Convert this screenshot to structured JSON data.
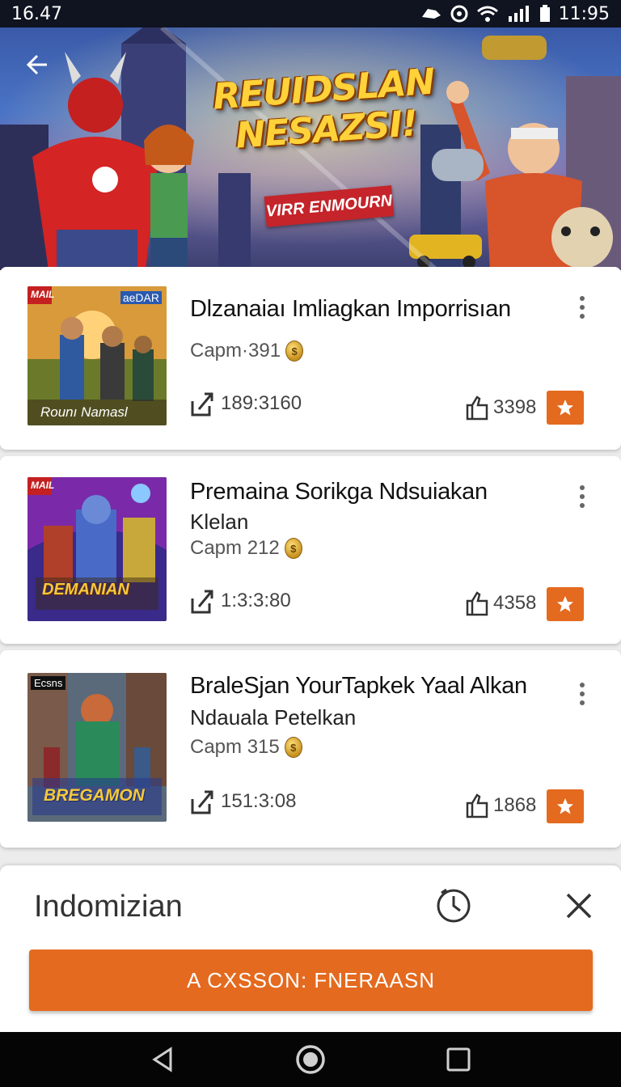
{
  "status_bar": {
    "time": "16.47",
    "clock": "11:95"
  },
  "hero": {
    "title_line1": "REUIDSLAN",
    "title_line2": "NESAZSI!",
    "subtitle": "VIRR ENMOURN"
  },
  "games": [
    {
      "title": "Dlzanaiaı Imliagkan Imporrisıan",
      "subtitle": "",
      "camp": "Capm·391",
      "share_count": "189:3160",
      "likes": "3398",
      "thumb_badge_left": "MAIL",
      "thumb_badge_right": "aeDAR",
      "thumb_caption": "Rounı Namasl"
    },
    {
      "title": "Premaina Sorikga Ndsuiakan",
      "subtitle": "Klelan",
      "camp": "Capm 212",
      "share_count": "1:3:3:80",
      "likes": "4358",
      "thumb_badge_left": "MAIL",
      "thumb_badge_right": "",
      "thumb_caption": "DEMANIAN"
    },
    {
      "title": "BraleSjan YourTapkek Yaal Alkan",
      "subtitle": "Ndauala Petelkan",
      "camp": "Capm 315",
      "share_count": "151:3:08",
      "likes": "1868",
      "thumb_badge_left": "Ecsns",
      "thumb_badge_right": "",
      "thumb_caption": "BREGAMON"
    }
  ],
  "panel": {
    "title": "Indomizian",
    "cta_label": "A CXSSON: FNERAASN"
  },
  "colors": {
    "accent": "#e46a1f",
    "status_bar": "#0f1420",
    "nav_bar": "#050505"
  },
  "icons": [
    "back-arrow-icon",
    "share-icon",
    "like-icon",
    "star-icon",
    "more-vert-icon",
    "clock-icon",
    "close-icon",
    "nav-back-icon",
    "nav-home-icon",
    "nav-recents-icon"
  ]
}
